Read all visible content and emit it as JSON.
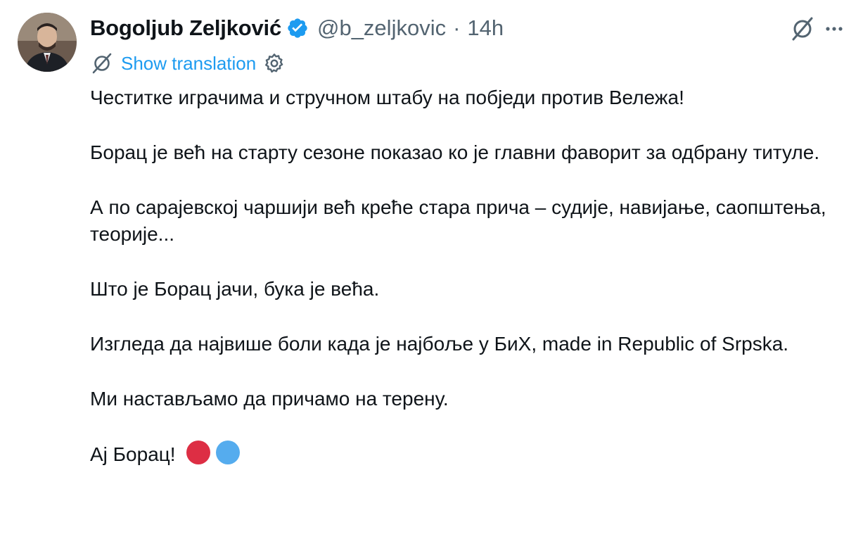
{
  "author": {
    "name": "Bogoljub Zeljković",
    "handle": "@b_zeljkovic",
    "separator": "·",
    "time": "14h",
    "verified_color": "#1d9bf0"
  },
  "translation": {
    "link_label": "Show translation"
  },
  "icons": {
    "grok": "grok-icon",
    "more": "more-icon",
    "translate": "grok-icon",
    "settings": "gear-icon"
  },
  "tweet": {
    "paragraphs": [
      "Честитке играчима и стручном штабу на побједи против Вележа!",
      "Борац је већ на старту сезоне показао ко је главни фаворит за одбрану титуле.",
      "А по сарајевској чаршији већ креће стара прича – судије, навијање, саопштења, теорије...",
      "Што је Борац јачи, бука је већа.",
      "Изгледа да највише боли када је најбоље у БиХ, made in Republic of Srpska.",
      "Ми настављамо да причамо на терену.",
      "Ај Борац!"
    ],
    "emoji_colors": [
      "#dd2e44",
      "#55acee"
    ]
  },
  "colors": {
    "text": "#0f1419",
    "secondary": "#536471",
    "link": "#1d9bf0"
  }
}
